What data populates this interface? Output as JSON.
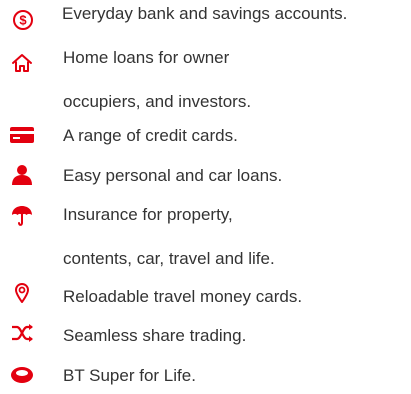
{
  "accent_color": "#e3000f",
  "items": [
    {
      "icon": "dollar-circle-icon",
      "lines": [
        "Everyday bank and savings accounts."
      ]
    },
    {
      "icon": "home-icon",
      "lines": [
        "Home loans for owner",
        "occupiers, and investors."
      ]
    },
    {
      "icon": "credit-card-icon",
      "lines": [
        "A range of credit cards."
      ]
    },
    {
      "icon": "person-icon",
      "lines": [
        "Easy personal and car loans."
      ]
    },
    {
      "icon": "umbrella-icon",
      "lines": [
        "Insurance for property,",
        "contents, car, travel and life."
      ]
    },
    {
      "icon": "map-pin-icon",
      "lines": [
        "Reloadable travel money cards."
      ]
    },
    {
      "icon": "shuffle-icon",
      "lines": [
        "Seamless share trading."
      ]
    },
    {
      "icon": "piggy-bank-icon",
      "lines": [
        "BT Super for Life."
      ]
    }
  ]
}
